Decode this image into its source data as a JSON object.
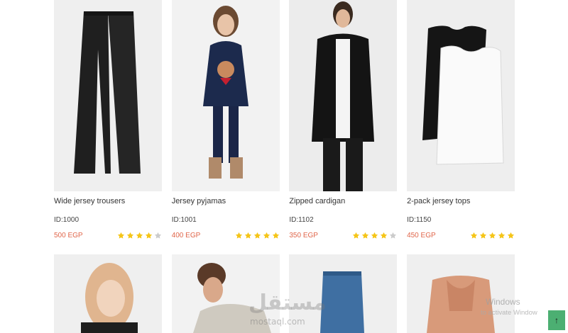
{
  "products": [
    {
      "name": "Wide jersey trousers",
      "id": "ID:1000",
      "price": "500 EGP",
      "rating": 4
    },
    {
      "name": "Jersey pyjamas",
      "id": "ID:1001",
      "price": "400 EGP",
      "rating": 5
    },
    {
      "name": "Zipped cardigan",
      "id": "ID:1102",
      "price": "350 EGP",
      "rating": 4
    },
    {
      "name": "2-pack jersey tops",
      "id": "ID:1150",
      "price": "450 EGP",
      "rating": 5
    }
  ],
  "colors": {
    "price": "#e0664a",
    "star_filled": "#f5c518",
    "star_empty": "#cccccc",
    "scroll_button": "#4caf72"
  },
  "watermark": {
    "logo_text": "مستقل",
    "site": "mostaql.com"
  },
  "windows_notice": {
    "title": "Windows",
    "subtitle": "to activate Window"
  },
  "scroll_top": {
    "icon": "arrow-up-icon",
    "glyph": "↑"
  }
}
